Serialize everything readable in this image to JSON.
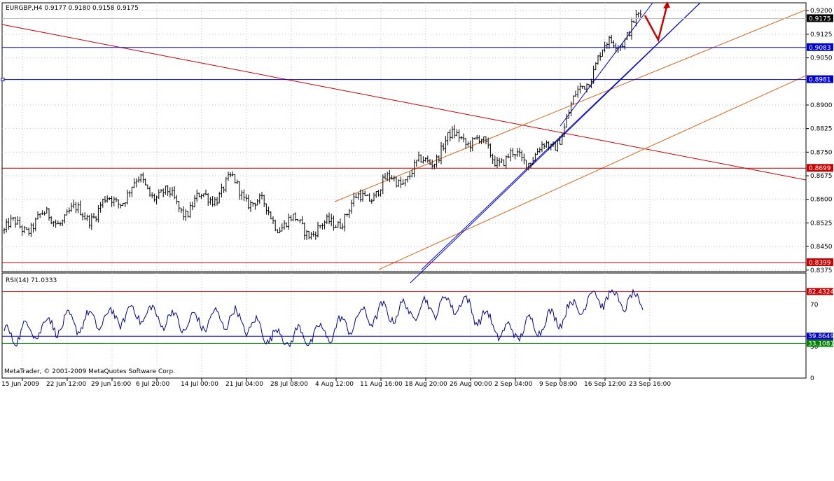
{
  "window": {
    "symbol_header": "EURGBP,H4  0.9177 0.9180 0.9158 0.9175",
    "copyright": "MetaTrader, © 2001-2009 MetaQuotes Software Corp."
  },
  "colors": {
    "background": "#ffffff",
    "grid": "#c0c0c0",
    "bars": "#000000",
    "blue_line": "#0000c8",
    "red_line": "#c80000",
    "orange_line": "#d2691e",
    "rsi_line": "#000080",
    "green_line": "#008000",
    "price_box": "#000000"
  },
  "price_axis": {
    "ticks": [
      "0.9200",
      "0.9125",
      "0.9050",
      "0.8900",
      "0.8825",
      "0.8750",
      "0.8675",
      "0.8600",
      "0.8525",
      "0.8450",
      "0.8375"
    ],
    "current_price_label": "0.9175",
    "level_labels": [
      {
        "value": 0.9083,
        "text": "0.9083",
        "color": "#0000c8"
      },
      {
        "value": 0.8981,
        "text": "0.8981",
        "color": "#0000c8"
      },
      {
        "value": 0.8699,
        "text": "0.8699",
        "color": "#c80000"
      },
      {
        "value": 0.8399,
        "text": "0.8399",
        "color": "#c80000"
      }
    ]
  },
  "time_axis": {
    "labels": [
      "15 Jun 2009",
      "22 Jun 12:00",
      "29 Jun 16:00",
      "6 Jul 20:00",
      "14 Jul 00:00",
      "21 Jul 04:00",
      "28 Jul 08:00",
      "4 Aug 12:00",
      "11 Aug 16:00",
      "18 Aug 20:00",
      "26 Aug 00:00",
      "2 Sep 04:00",
      "9 Sep 08:00",
      "16 Sep 12:00",
      "23 Sep 16:00"
    ]
  },
  "rsi": {
    "header": "RSI(14) 71.0333",
    "ticks": [
      "70",
      "30",
      "0"
    ],
    "level_labels": [
      {
        "value": 82.4324,
        "text": "82.4324",
        "color": "#c80000"
      },
      {
        "value": 39.8649,
        "text": "39.8649",
        "color": "#0000c8"
      },
      {
        "value": 33.1081,
        "text": "33.1081",
        "color": "#008000"
      }
    ]
  },
  "chart_data": {
    "type": "bar",
    "symbol": "EURGBP",
    "timeframe": "H4",
    "last_ohlc": {
      "open": 0.9177,
      "high": 0.918,
      "low": 0.9158,
      "close": 0.9175
    },
    "anchors": [
      {
        "x": "15 Jun 2009",
        "y": 0.85
      },
      {
        "x": "22 Jun 12:00",
        "y": 0.854
      },
      {
        "x": "29 Jun 16:00",
        "y": 0.856
      },
      {
        "x": "6 Jul 20:00",
        "y": 0.865
      },
      {
        "x": "14 Jul 00:00",
        "y": 0.857
      },
      {
        "x": "21 Jul 04:00",
        "y": 0.865
      },
      {
        "x": "28 Jul 08:00",
        "y": 0.853
      },
      {
        "x": "4 Aug 12:00",
        "y": 0.85
      },
      {
        "x": "11 Aug 16:00",
        "y": 0.862
      },
      {
        "x": "18 Aug 20:00",
        "y": 0.869
      },
      {
        "x": "26 Aug 00:00",
        "y": 0.881
      },
      {
        "x": "2 Sep 04:00",
        "y": 0.872
      },
      {
        "x": "9 Sep 08:00",
        "y": 0.876
      },
      {
        "x": "16 Sep 12:00",
        "y": 0.905
      },
      {
        "x": "23 Sep 16:00",
        "y": 0.9175
      }
    ],
    "horizontal_levels": [
      0.9083,
      0.8981,
      0.8699,
      0.8399
    ],
    "ylim": [
      0.837,
      0.9225
    ],
    "grid": true,
    "rsi_series": {
      "name": "RSI(14)",
      "last": 71.0333,
      "anchors": [
        {
          "x": "15 Jun 2009",
          "y": 40
        },
        {
          "x": "22 Jun 12:00",
          "y": 50
        },
        {
          "x": "29 Jun 16:00",
          "y": 55
        },
        {
          "x": "6 Jul 20:00",
          "y": 62
        },
        {
          "x": "14 Jul 00:00",
          "y": 52
        },
        {
          "x": "21 Jul 04:00",
          "y": 58
        },
        {
          "x": "28 Jul 08:00",
          "y": 38
        },
        {
          "x": "4 Aug 12:00",
          "y": 42
        },
        {
          "x": "11 Aug 16:00",
          "y": 60
        },
        {
          "x": "18 Aug 20:00",
          "y": 65
        },
        {
          "x": "26 Aug 00:00",
          "y": 72
        },
        {
          "x": "2 Sep 04:00",
          "y": 42
        },
        {
          "x": "9 Sep 08:00",
          "y": 55
        },
        {
          "x": "16 Sep 12:00",
          "y": 78
        },
        {
          "x": "23 Sep 16:00",
          "y": 71
        }
      ],
      "levels": [
        82.4324,
        39.8649,
        33.1081
      ],
      "ylim": [
        0,
        100
      ]
    }
  }
}
